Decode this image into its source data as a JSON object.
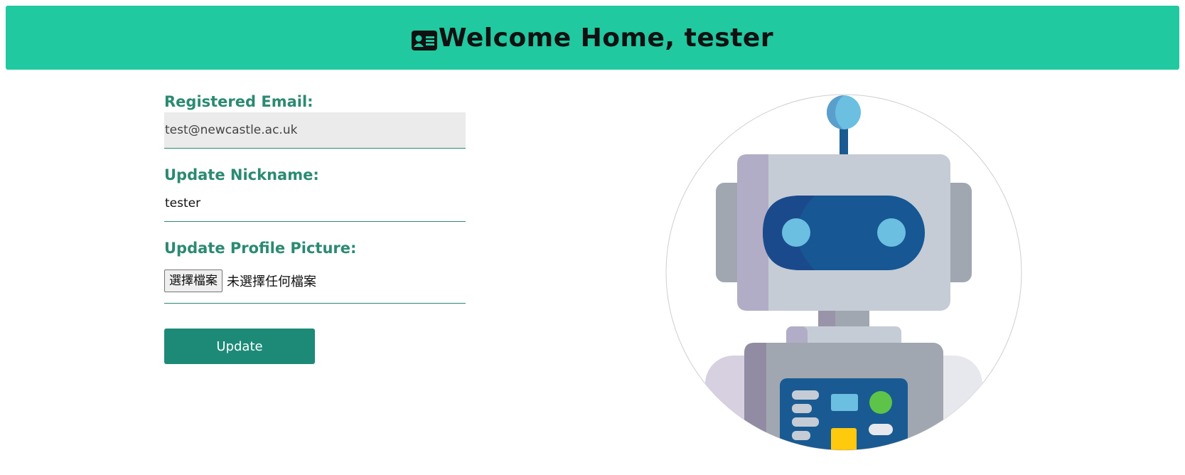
{
  "header": {
    "title": "Welcome Home, tester",
    "icon": "id-card-icon",
    "background": "#21c9a0"
  },
  "form": {
    "email_label": "Registered Email:",
    "email_value": "test@newcastle.ac.uk",
    "nickname_label": "Update Nickname:",
    "nickname_value": "tester",
    "picture_label": "Update Profile Picture:",
    "file_button_label": "選擇檔案",
    "file_status": "未選擇任何檔案",
    "update_label": "Update",
    "accent": "#2b8a72",
    "button_color": "#1d8a78"
  },
  "avatar": {
    "icon": "robot-avatar"
  }
}
